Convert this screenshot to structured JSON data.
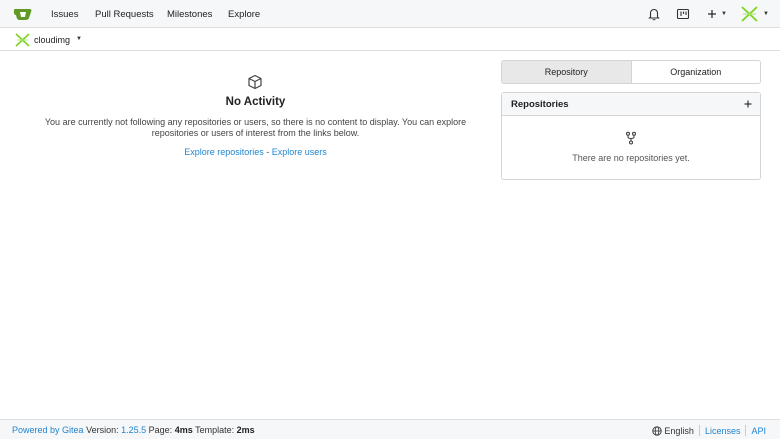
{
  "header": {
    "logo_icon": "gitea-tea-icon",
    "nav": [
      {
        "label": "Issues"
      },
      {
        "label": "Pull Requests"
      },
      {
        "label": "Milestones"
      },
      {
        "label": "Explore"
      }
    ],
    "icons": [
      "bell-icon",
      "kanban-icon",
      "plus-icon",
      "avatar"
    ]
  },
  "context": {
    "name": "cloudimg"
  },
  "feed": {
    "title": "No Activity",
    "description": "You are currently not following any repositories or users, so there is no content to display. You can explore repositories or users of interest from the links below.",
    "link_repos": "Explore repositories",
    "link_separator": " - ",
    "link_users": "Explore users"
  },
  "switcher": {
    "tabs": [
      "Repository",
      "Organization"
    ],
    "active": "Repository"
  },
  "repos": {
    "title": "Repositories",
    "empty": "There are no repositories yet."
  },
  "footer": {
    "powered_prefix": "Powered by Gitea",
    "version_label": "Version:",
    "version": "1.25.5",
    "page_label": "Page:",
    "page_time": "4ms",
    "template_label": "Template:",
    "template_time": "2ms",
    "language": "English",
    "licenses": "Licenses",
    "api": "API"
  },
  "colors": {
    "link": "#2185d0",
    "brand_green": "#609926"
  }
}
